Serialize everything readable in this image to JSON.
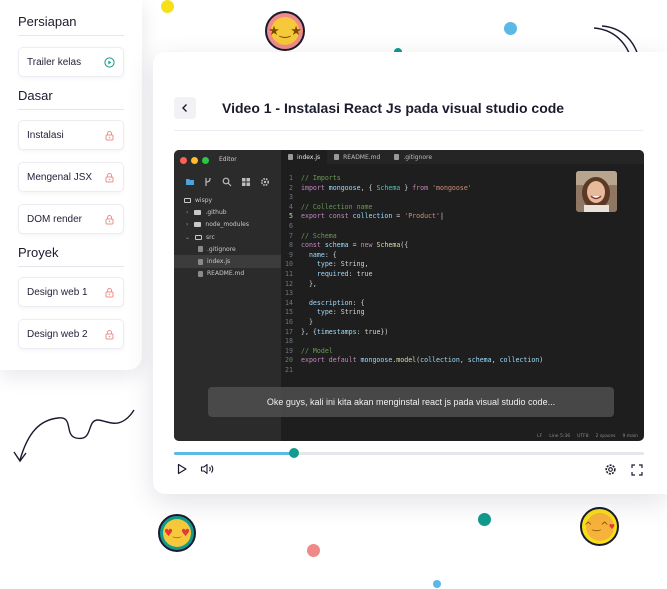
{
  "sidebar": {
    "sections": [
      {
        "title": "Persiapan",
        "items": [
          {
            "label": "Trailer kelas",
            "icon": "play-circle-icon"
          }
        ]
      },
      {
        "title": "Dasar",
        "items": [
          {
            "label": "Instalasi",
            "icon": "lock-icon"
          },
          {
            "label": "Mengenal JSX",
            "icon": "lock-icon"
          },
          {
            "label": "DOM render",
            "icon": "lock-icon"
          }
        ]
      },
      {
        "title": "Proyek",
        "items": [
          {
            "label": "Design web 1",
            "icon": "lock-icon"
          },
          {
            "label": "Design web 2",
            "icon": "lock-icon"
          }
        ]
      }
    ]
  },
  "header": {
    "back_icon": "chevron-left-icon",
    "title": "Video 1 - Instalasi React Js pada visual studio code"
  },
  "editor": {
    "window_title": "Editor",
    "tools": [
      "files-icon",
      "source-control-icon",
      "search-icon",
      "extensions-icon",
      "settings-icon"
    ],
    "tree": [
      {
        "label": "wispy",
        "kind": "root"
      },
      {
        "label": ".github",
        "kind": "folder"
      },
      {
        "label": "node_modules",
        "kind": "folder"
      },
      {
        "label": "src",
        "kind": "folder-open"
      },
      {
        "label": ".gitignore",
        "kind": "file"
      },
      {
        "label": "index.js",
        "kind": "file",
        "selected": true
      },
      {
        "label": "README.md",
        "kind": "file"
      }
    ],
    "tabs": [
      {
        "label": "index.js",
        "active": true
      },
      {
        "label": "README.md",
        "active": false
      },
      {
        "label": ".gitignore",
        "active": false
      }
    ],
    "current_line": 5,
    "code": [
      [
        [
          "cm",
          "// Imports"
        ]
      ],
      [
        [
          "kw",
          "import "
        ],
        [
          "id",
          "mongoose"
        ],
        [
          "pl",
          ", { "
        ],
        [
          "ty",
          "Schema"
        ],
        [
          "pl",
          " } "
        ],
        [
          "kw",
          "from "
        ],
        [
          "st",
          "'mongoose'"
        ]
      ],
      [],
      [
        [
          "cm",
          "// Collection name"
        ]
      ],
      [
        [
          "kw",
          "export const "
        ],
        [
          "id",
          "collection"
        ],
        [
          "pl",
          " = "
        ],
        [
          "st",
          "'Product'"
        ],
        [
          "pl",
          "|"
        ]
      ],
      [],
      [
        [
          "cm",
          "// Schema"
        ]
      ],
      [
        [
          "kw",
          "const "
        ],
        [
          "id",
          "schema"
        ],
        [
          "pl",
          " = "
        ],
        [
          "kw",
          "new "
        ],
        [
          "fn",
          "Schema"
        ],
        [
          "pl",
          "({"
        ]
      ],
      [
        [
          "pl",
          "  "
        ],
        [
          "id",
          "name"
        ],
        [
          "pl",
          ": {"
        ]
      ],
      [
        [
          "pl",
          "    "
        ],
        [
          "id",
          "type"
        ],
        [
          "pl",
          ": String,"
        ]
      ],
      [
        [
          "pl",
          "    "
        ],
        [
          "id",
          "required"
        ],
        [
          "pl",
          ": true"
        ]
      ],
      [
        [
          "pl",
          "  },"
        ]
      ],
      [],
      [
        [
          "pl",
          "  "
        ],
        [
          "id",
          "description"
        ],
        [
          "pl",
          ": {"
        ]
      ],
      [
        [
          "pl",
          "    "
        ],
        [
          "id",
          "type"
        ],
        [
          "pl",
          ": String"
        ]
      ],
      [
        [
          "pl",
          "  }"
        ]
      ],
      [
        [
          "pl",
          "}, {"
        ],
        [
          "id",
          "timestamps"
        ],
        [
          "pl",
          ": true})"
        ]
      ],
      [],
      [
        [
          "cm",
          "// Model"
        ]
      ],
      [
        [
          "kw",
          "export default "
        ],
        [
          "id",
          "mongoose"
        ],
        [
          "pl",
          "."
        ],
        [
          "fn",
          "model"
        ],
        [
          "pl",
          "("
        ],
        [
          "id",
          "collection"
        ],
        [
          "pl",
          ", "
        ],
        [
          "id",
          "schema"
        ],
        [
          "pl",
          ", "
        ],
        [
          "id",
          "collection"
        ],
        [
          "pl",
          ")"
        ]
      ],
      []
    ],
    "status": [
      "LF",
      "Line 5:36",
      "UTF8",
      "2 spaces",
      "9 main"
    ]
  },
  "video": {
    "subtitle": "Oke guys, kali ini kita akan menginstal react js pada visual studio code...",
    "progress_fraction": 0.255,
    "controls": {
      "play_icon": "play-icon",
      "volume_icon": "volume-icon",
      "settings_icon": "gear-icon",
      "fullscreen_icon": "fullscreen-icon"
    }
  },
  "decorations": {
    "emojis": [
      "star-struck-emoji",
      "heart-eyes-emoji",
      "smiling-hearts-emoji"
    ]
  },
  "colors": {
    "accent_teal": "#129a8f",
    "progress_blue": "#5cb8e4",
    "lock_red": "#ef8f8a",
    "dot_yellow": "#f7e018",
    "dot_pink": "#f08a88"
  }
}
